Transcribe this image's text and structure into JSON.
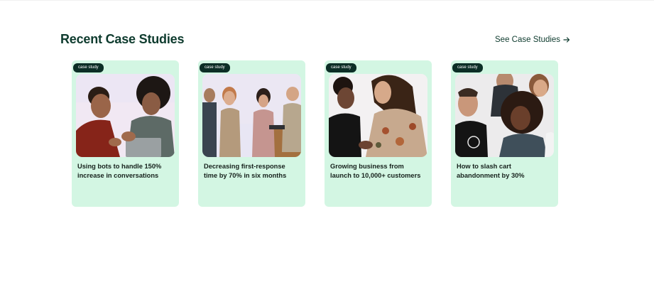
{
  "section": {
    "title": "Recent Case Studies",
    "see_all_label": "See Case Studies"
  },
  "cards": [
    {
      "badge": "case study",
      "title": "Using bots to handle 150% increase in conversations"
    },
    {
      "badge": "case study",
      "title": "Decreasing first-response time by 70% in six months"
    },
    {
      "badge": "case study",
      "title": "Growing business from launch to 10,000+ customers"
    },
    {
      "badge": "case study",
      "title": "How to slash cart abandonment by 30%"
    }
  ],
  "colors": {
    "card_bg": "#d3f6e3",
    "badge_bg": "#0c2e26",
    "heading": "#0e3b2e"
  },
  "icons": {
    "see_all": "arrow-right-icon"
  }
}
